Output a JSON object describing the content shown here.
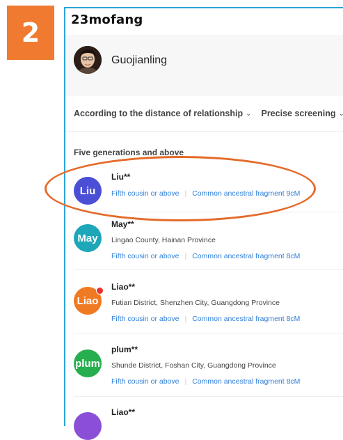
{
  "step_number": "2",
  "brand": {
    "logo_text": "23mofang"
  },
  "profile": {
    "name": "Guojianling"
  },
  "filters": {
    "sort_label": "According to the distance of relationship",
    "screen_label": "Precise screening"
  },
  "section": {
    "title": "Five generations and above"
  },
  "matches": [
    {
      "avatar_text": "Liu",
      "avatar_color": "#4a4fd6",
      "name": "Liu**",
      "location": "",
      "relationship": "Fifth cousin or above",
      "fragment": "Common ancestral fragment 9cM",
      "notification": false
    },
    {
      "avatar_text": "May",
      "avatar_color": "#1da7b8",
      "name": "May**",
      "location": "Lingao County, Hainan Province",
      "relationship": "Fifth cousin or above",
      "fragment": "Common ancestral fragment 8cM",
      "notification": false
    },
    {
      "avatar_text": "Liao",
      "avatar_color": "#f07a22",
      "name": "Liao**",
      "location": "Futian District, Shenzhen City, Guangdong Province",
      "relationship": "Fifth cousin or above",
      "fragment": "Common ancestral fragment 8cM",
      "notification": true
    },
    {
      "avatar_text": "plum",
      "avatar_color": "#27ae4f",
      "name": "plum**",
      "location": "Shunde District, Foshan City, Guangdong Province",
      "relationship": "Fifth cousin or above",
      "fragment": "Common ancestral fragment 8cM",
      "notification": false
    },
    {
      "avatar_text": "",
      "avatar_color": "#8a4fd6",
      "name": "Liao**",
      "location": "",
      "relationship": "",
      "fragment": "",
      "notification": false
    }
  ],
  "colors": {
    "step_badge": "#f07a2f",
    "frame_border": "#2aa6d8",
    "highlight_oval": "#e46b2a",
    "link_blue": "#2f7fd8"
  }
}
